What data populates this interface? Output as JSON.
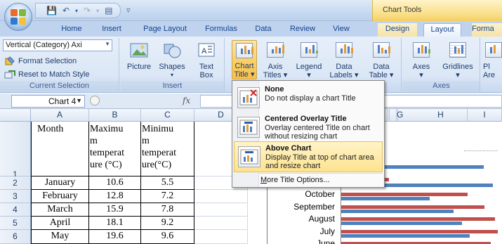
{
  "quick_access": {
    "title_more": "▿"
  },
  "context": {
    "label": "Chart Tools"
  },
  "tabs": [
    "Home",
    "Insert",
    "Page Layout",
    "Formulas",
    "Data",
    "Review",
    "View",
    "Design",
    "Layout",
    "Forma"
  ],
  "ribbon": {
    "current_selection": {
      "combo_value": "Vertical (Category) Axi",
      "format_selection": "Format Selection",
      "reset_to_match": "Reset to Match Style",
      "label": "Current Selection"
    },
    "insert": {
      "picture": "Picture",
      "shapes": "Shapes",
      "text_box_1": "Text",
      "text_box_2": "Box",
      "label": "Insert"
    },
    "labels": {
      "chart_title_1": "Chart",
      "chart_title_2": "Title ▾",
      "axis_titles_1": "Axis",
      "axis_titles_2": "Titles ▾",
      "legend_1": "Legend",
      "legend_2": "▾",
      "data_labels_1": "Data",
      "data_labels_2": "Labels ▾",
      "data_table_1": "Data",
      "data_table_2": "Table ▾"
    },
    "axes": {
      "axes_1": "Axes",
      "axes_2": "▾",
      "gridlines_1": "Gridlines",
      "gridlines_2": "▾",
      "label": "Axes"
    },
    "plot_area_1": "Pl",
    "plot_area_2": "Are"
  },
  "formula_bar": {
    "name_box": "Chart 4",
    "fx": "fx"
  },
  "columns": [
    "A",
    "B",
    "C",
    "D",
    "",
    "",
    "G",
    "H",
    "I"
  ],
  "rows": [
    "1",
    "2",
    "3",
    "4",
    "5",
    "6"
  ],
  "sheet": {
    "header": {
      "month": "Month",
      "max": [
        "Maximu",
        "m",
        "temperat",
        "ure (°C)"
      ],
      "min": [
        "Minimu",
        "m",
        "temperat",
        "ure(°C)"
      ]
    },
    "data": [
      {
        "month": "January",
        "max": "10.6",
        "min": "5.5"
      },
      {
        "month": "February",
        "max": "12.8",
        "min": "7.2"
      },
      {
        "month": "March",
        "max": "15.9",
        "min": "7.8"
      },
      {
        "month": "April",
        "max": "18.1",
        "min": "9.2"
      },
      {
        "month": "May",
        "max": "19.6",
        "min": "9.6"
      }
    ]
  },
  "chart_data": {
    "type": "bar",
    "orientation": "horizontal",
    "categories": [
      "October",
      "September",
      "August",
      "July",
      "June"
    ],
    "series": [
      {
        "color": "#c0504d",
        "values": [
          17.6,
          19.9,
          21.4,
          21.8,
          20.8
        ]
      },
      {
        "color": "#4f81bd",
        "values": [
          12.3,
          15.6,
          16.8,
          17.9,
          15.5
        ]
      }
    ],
    "partial_bars_top": [
      {
        "color": "#4f81bd",
        "length_rel": 0.9
      },
      {
        "color": "#c0504d",
        "length_rel": 0.3
      },
      {
        "color": "#4f81bd",
        "length_rel": 0.96
      }
    ]
  },
  "dropdown": {
    "items": [
      {
        "title": "None",
        "desc": "Do not display a chart Title"
      },
      {
        "title": "Centered Overlay Title",
        "desc": "Overlay centered Title on chart without resizing chart"
      },
      {
        "title": "Above Chart",
        "desc": "Display Title at top of chart area and resize chart"
      }
    ],
    "more_prefix": "M",
    "more_rest": "ore Title Options..."
  }
}
